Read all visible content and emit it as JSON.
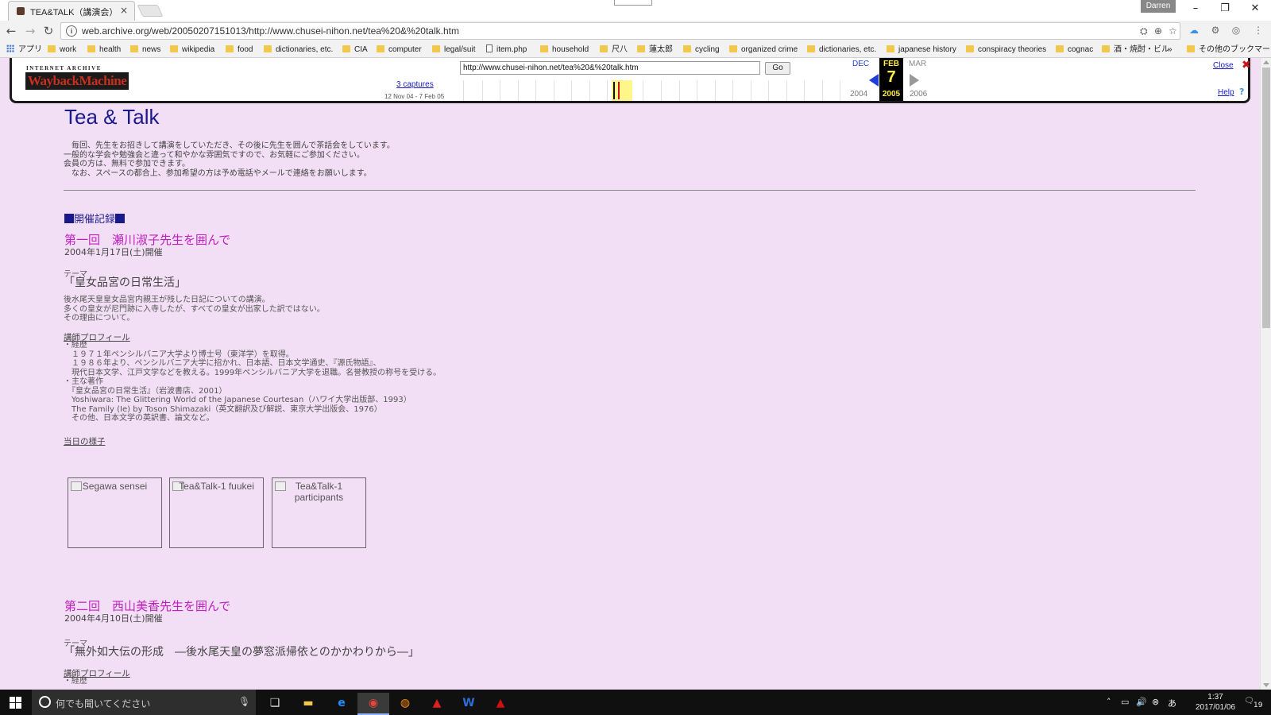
{
  "browser": {
    "tab_title": "TEA&TALK（講演会）",
    "tab_close": "×",
    "profile_name": "Darren",
    "win_min": "–",
    "win_restore": "❐",
    "win_close": "✕",
    "url": "web.archive.org/web/20050207151013/http://www.chusei-nihon.net/tea%20&%20talk.htm",
    "back": "←",
    "forward": "→",
    "reload": "↻",
    "info": "i",
    "bookmarks": [
      {
        "label": "アプリ",
        "kind": "apps"
      },
      {
        "label": "work",
        "kind": "folder"
      },
      {
        "label": "health",
        "kind": "folder"
      },
      {
        "label": "news",
        "kind": "folder"
      },
      {
        "label": "wikipedia",
        "kind": "folder"
      },
      {
        "label": "food",
        "kind": "folder"
      },
      {
        "label": "dictionaries, etc.",
        "kind": "folder"
      },
      {
        "label": "CIA",
        "kind": "folder"
      },
      {
        "label": "computer",
        "kind": "folder"
      },
      {
        "label": "legal/suit",
        "kind": "folder"
      },
      {
        "label": "item.php",
        "kind": "page"
      },
      {
        "label": "household",
        "kind": "folder"
      },
      {
        "label": "尺八",
        "kind": "folder"
      },
      {
        "label": "蓮太郎",
        "kind": "folder"
      },
      {
        "label": "cycling",
        "kind": "folder"
      },
      {
        "label": "organized crime",
        "kind": "folder"
      },
      {
        "label": "dictionaries, etc.",
        "kind": "folder"
      },
      {
        "label": "japanese history",
        "kind": "folder"
      },
      {
        "label": "conspiracy theories",
        "kind": "folder"
      },
      {
        "label": "cognac",
        "kind": "folder"
      },
      {
        "label": "酒・焼酎・ビル",
        "kind": "folder"
      }
    ],
    "bookmarks_more": "»",
    "other_bookmarks": "その他のブックマーク"
  },
  "wayback": {
    "logo_top": "INTERNET ARCHIVE",
    "logo": "WaybackMachine",
    "url_value": "http://www.chusei-nihon.net/tea%20&%20talk.htm",
    "go_label": "Go",
    "captures": "3 captures",
    "range": "12 Nov 04 - 7 Feb 05",
    "prev_month": "DEC",
    "current_month": "FEB",
    "next_month": "MAR",
    "current_day": "7",
    "prev_year": "2004",
    "current_year": "2005",
    "next_year": "2006",
    "close_label": "Close",
    "help_label": "Help"
  },
  "page": {
    "title": "Tea & Talk",
    "intro": [
      "　毎回、先生をお招きして講演をしていただき、その後に先生を囲んで茶話会をしています。",
      "一般的な学会や勉強会と違って和やかな雰囲気ですので、お気軽にご参加ください。",
      "会員の方は、無料で参加できます。",
      "　なお、スペースの都合上、参加希望の方は予め電話やメールで連絡をお願いします。"
    ],
    "section_heading": "開催記録",
    "event1": {
      "title": "第一回　瀬川淑子先生を囲んで",
      "date": "2004年1月17日(土)開催",
      "theme_label": "テーマ",
      "theme": "「皇女品宮の日常生活」",
      "desc": [
        "後水尾天皇皇女品宮内親王が残した日記についての講演。",
        "多くの皇女が尼門跡に入寺したが、すべての皇女が出家した訳ではない。",
        "その理由について。"
      ],
      "profile_link": "講師プロフィール",
      "career_label": "・経歴",
      "career": [
        "　１９７１年ペンシルバニア大学より博士号（東洋学）を取得。",
        "　１９８６年より、ペンシルバニア大学に招かれ、日本語、日本文学通史、『源氏物語』、",
        "　現代日本文学、江戸文学などを教える。1999年ペンシルバニア大学を退職。名誉教授の称号を受ける。"
      ],
      "works_label": "・主な著作",
      "works": [
        "　『皇女品宮の日常生活』（岩波書店、2001）",
        "　Yoshiwara: The Glittering World of the Japanese Courtesan（ハワイ大学出版部、1993）",
        "　The Family (Ie) by Toson Shimazaki（英文翻訳及び解説、東京大学出版会、1976）",
        "　その他、日本文学の英訳書、論文など。"
      ],
      "day_link": "当日の様子",
      "images": [
        {
          "alt": "Segawa sensei"
        },
        {
          "alt": "Tea&Talk-1 fuukei"
        },
        {
          "alt": "Tea&Talk-1 participants"
        }
      ]
    },
    "event2": {
      "title": "第二回　西山美香先生を囲んで",
      "date": "2004年4月10日(土)開催",
      "theme_label": "テーマ",
      "theme": "「無外如大伝の形成　―後水尾天皇の夢窓派帰依とのかかわりから―」",
      "profile_link": "講師プロフィール",
      "career_label": "・経歴"
    }
  },
  "taskbar": {
    "search_placeholder": "何でも聞いてください",
    "time": "1:37",
    "date": "2017/01/06",
    "notification_count": "19"
  },
  "colors": {
    "page_bg": "#f3dff5",
    "title_blue": "#1a1a8c",
    "event_magenta": "#c020c0",
    "wayback_yellow": "#ffef3f",
    "taskbar": "#101010"
  }
}
